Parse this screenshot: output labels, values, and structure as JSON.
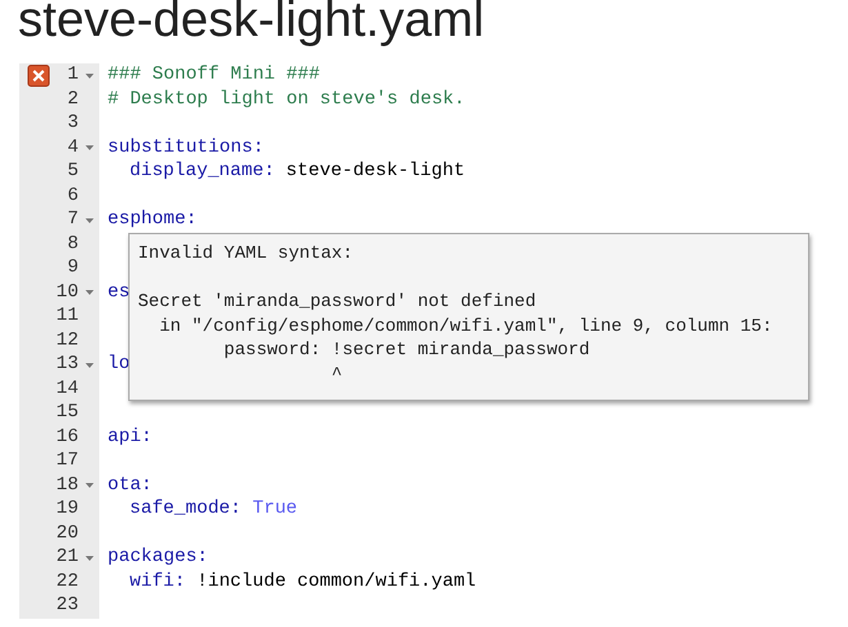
{
  "title": "steve-desk-light.yaml",
  "editor": {
    "lines": [
      {
        "number": "1",
        "fold": true,
        "error": true,
        "indent": false,
        "tokens": [
          {
            "kind": "comment",
            "text": "### Sonoff Mini ###"
          }
        ]
      },
      {
        "number": "2",
        "fold": false,
        "error": false,
        "indent": false,
        "tokens": [
          {
            "kind": "comment",
            "text": "# Desktop light on steve's desk."
          }
        ]
      },
      {
        "number": "3",
        "fold": false,
        "error": false,
        "indent": false
      },
      {
        "number": "4",
        "fold": true,
        "error": false,
        "indent": false,
        "tokens": [
          {
            "kind": "key",
            "text": "substitutions:"
          }
        ]
      },
      {
        "number": "5",
        "fold": false,
        "error": false,
        "indent": true,
        "tokens": [
          {
            "kind": "key",
            "text": "display_name:"
          },
          {
            "kind": "plain",
            "text": "steve-desk-light"
          }
        ]
      },
      {
        "number": "6",
        "fold": false,
        "error": false,
        "indent": false
      },
      {
        "number": "7",
        "fold": true,
        "error": false,
        "indent": false,
        "tokens": [
          {
            "kind": "key",
            "text": "esphome:"
          }
        ]
      },
      {
        "number": "8",
        "fold": false,
        "error": false,
        "indent": false
      },
      {
        "number": "9",
        "fold": false,
        "error": false,
        "indent": false
      },
      {
        "number": "10",
        "fold": true,
        "error": false,
        "indent": false,
        "tokens": [
          {
            "kind": "key",
            "text": "es"
          }
        ]
      },
      {
        "number": "11",
        "fold": false,
        "error": false,
        "indent": false
      },
      {
        "number": "12",
        "fold": false,
        "error": false,
        "indent": false
      },
      {
        "number": "13",
        "fold": true,
        "error": false,
        "indent": false,
        "tokens": [
          {
            "kind": "key",
            "text": "lo"
          }
        ]
      },
      {
        "number": "14",
        "fold": false,
        "error": false,
        "indent": false
      },
      {
        "number": "15",
        "fold": false,
        "error": false,
        "indent": false
      },
      {
        "number": "16",
        "fold": false,
        "error": false,
        "indent": false,
        "tokens": [
          {
            "kind": "key",
            "text": "api:"
          }
        ]
      },
      {
        "number": "17",
        "fold": false,
        "error": false,
        "indent": false
      },
      {
        "number": "18",
        "fold": true,
        "error": false,
        "indent": false,
        "tokens": [
          {
            "kind": "key",
            "text": "ota:"
          }
        ]
      },
      {
        "number": "19",
        "fold": false,
        "error": false,
        "indent": true,
        "tokens": [
          {
            "kind": "key",
            "text": "safe_mode:"
          },
          {
            "kind": "boolean",
            "text": "True"
          }
        ]
      },
      {
        "number": "20",
        "fold": false,
        "error": false,
        "indent": false
      },
      {
        "number": "21",
        "fold": true,
        "error": false,
        "indent": false,
        "tokens": [
          {
            "kind": "key",
            "text": "packages:"
          }
        ]
      },
      {
        "number": "22",
        "fold": false,
        "error": false,
        "indent": true,
        "tokens": [
          {
            "kind": "key",
            "text": "wifi:"
          },
          {
            "kind": "plain",
            "text": "!include common/wifi.yaml"
          }
        ]
      },
      {
        "number": "23",
        "fold": false,
        "error": false,
        "indent": false
      }
    ]
  },
  "tooltip": {
    "heading": "Invalid YAML syntax:",
    "message": [
      "Secret 'miranda_password' not defined",
      "  in \"/config/esphome/common/wifi.yaml\", line 9, column 15:",
      "        password: !secret miranda_password",
      "                  ^"
    ]
  }
}
